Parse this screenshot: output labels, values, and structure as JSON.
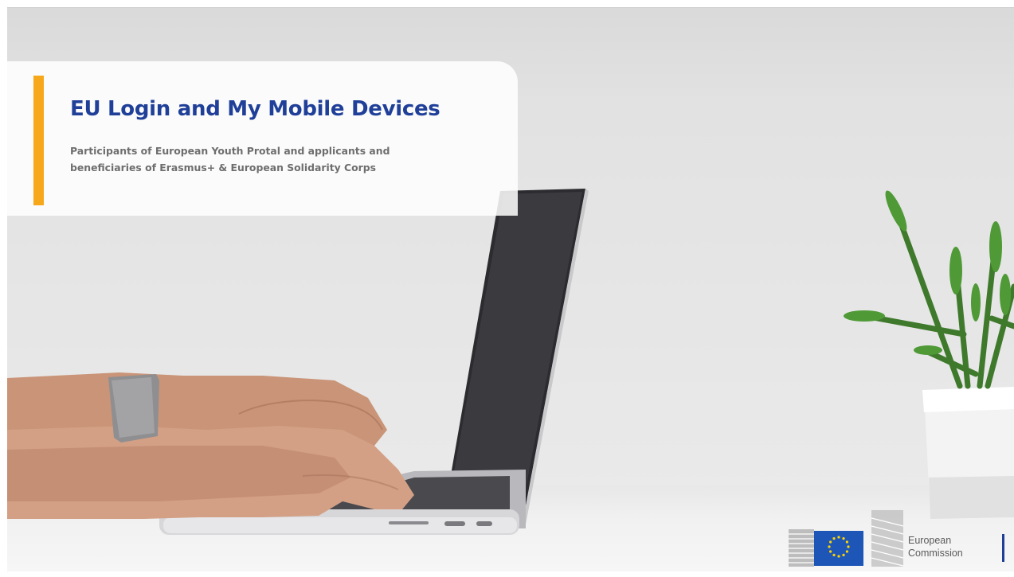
{
  "title_card": {
    "title": "EU Login and My Mobile Devices",
    "subtitle": "Participants of European Youth Protal and applicants and\nbeneficiaries of Erasmus+ & European Solidarity Corps",
    "accent_color": "#f6a81a",
    "title_color": "#1f3f99"
  },
  "logo": {
    "text": "European\nCommission",
    "flag_color": "#1e56b8",
    "star_color": "#ffd500"
  }
}
